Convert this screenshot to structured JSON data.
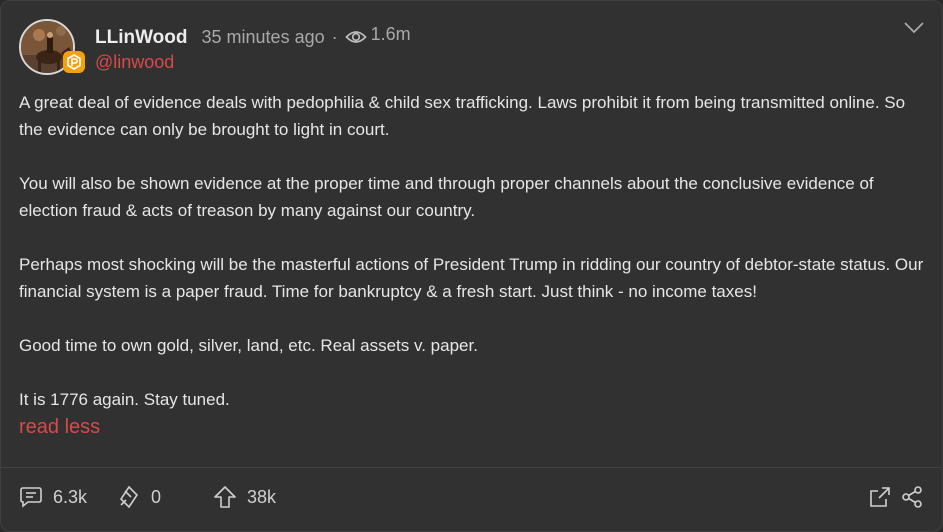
{
  "post": {
    "author": {
      "display_name": "LLinWood",
      "handle": "@linwood",
      "avatar_icon": "avatar-image",
      "badge_icon": "verified-p-badge-icon"
    },
    "meta": {
      "time": "35 minutes ago",
      "separator": "·",
      "views": "1.6m"
    },
    "paragraphs": [
      "A great deal of evidence deals with pedophilia & child sex trafficking. Laws prohibit it from being transmitted online. So the evidence can only be brought to light in court.",
      "You will also be shown evidence at the proper time and through proper channels about the conclusive evidence of election fraud & acts of treason by many against our country.",
      "Perhaps most shocking will be the masterful actions of President Trump in ridding our country of debtor-state status. Our financial system is a paper fraud. Time for bankruptcy & a fresh start. Just think - no income taxes!",
      "Good time to own gold, silver, land, etc. Real assets v. paper.",
      "It is 1776 again. Stay tuned."
    ],
    "read_less": "read less"
  },
  "footer": {
    "comments": "6.3k",
    "echoes": "0",
    "upvotes": "38k",
    "icons": [
      "comment-icon",
      "echo-icon",
      "upvote-icon",
      "external-link-icon",
      "share-icon"
    ]
  },
  "colors": {
    "background": "#313131",
    "accent": "#d84a4a",
    "badge": "#f2a20f",
    "text": "#e6e6e6",
    "muted": "#a9a9a9"
  }
}
